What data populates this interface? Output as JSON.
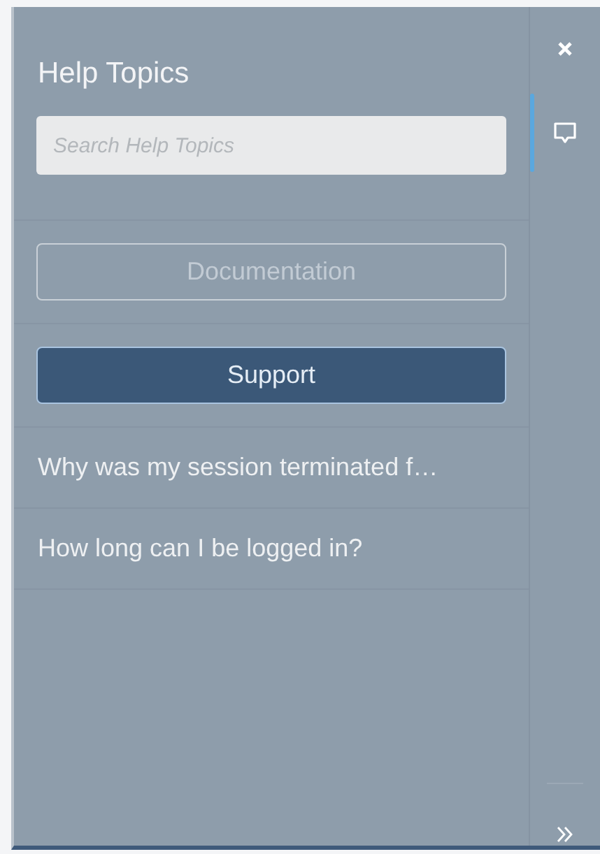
{
  "panel": {
    "title": "Help Topics"
  },
  "search": {
    "placeholder": "Search Help Topics"
  },
  "tabs": [
    {
      "label": "Documentation",
      "selected": false
    },
    {
      "label": "Support",
      "selected": true
    }
  ],
  "topics": [
    "Why was my session terminated f…",
    "How long can I be logged in?"
  ],
  "side_tabs": [
    {
      "kind": "chat",
      "selected": true
    }
  ]
}
